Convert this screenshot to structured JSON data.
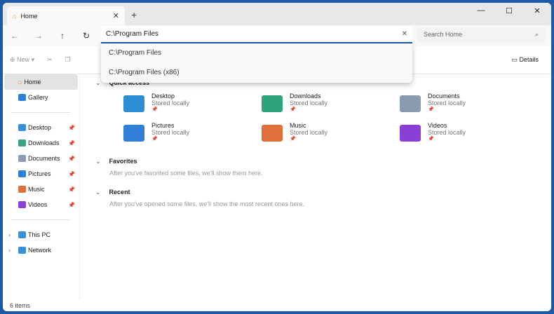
{
  "tab": {
    "title": "Home",
    "close": "✕",
    "new": "+"
  },
  "window_controls": {
    "minimize": "—",
    "maximize": "☐",
    "close": "✕"
  },
  "address": {
    "value": "C:\\Program Files",
    "clear": "✕"
  },
  "search": {
    "placeholder": "Search Home"
  },
  "suggestions": [
    "C:\\Program Files",
    "C:\\Program Files (x86)"
  ],
  "toolbar": {
    "new": "New",
    "details": "Details"
  },
  "sidebar": {
    "home": "Home",
    "gallery": "Gallery",
    "pinned": [
      {
        "label": "Desktop",
        "color": "#3a8fd6"
      },
      {
        "label": "Downloads",
        "color": "#3aa37a"
      },
      {
        "label": "Documents",
        "color": "#8a9bb0"
      },
      {
        "label": "Pictures",
        "color": "#2f7ed8"
      },
      {
        "label": "Music",
        "color": "#e0703a"
      },
      {
        "label": "Videos",
        "color": "#8a3fd6"
      }
    ],
    "this_pc": "This PC",
    "network": "Network"
  },
  "main": {
    "quick_access": "Quick access",
    "items": [
      {
        "name": "Desktop",
        "sub": "Stored locally",
        "color": "#2f8fd6"
      },
      {
        "name": "Downloads",
        "sub": "Stored locally",
        "color": "#2fa37a"
      },
      {
        "name": "Documents",
        "sub": "Stored locally",
        "color": "#8a9bb0"
      },
      {
        "name": "Pictures",
        "sub": "Stored locally",
        "color": "#2f7ed8"
      },
      {
        "name": "Music",
        "sub": "Stored locally",
        "color": "#e0703a"
      },
      {
        "name": "Videos",
        "sub": "Stored locally",
        "color": "#8a3fd6"
      }
    ],
    "favorites": "Favorites",
    "favorites_hint": "After you've favorited some files, we'll show them here.",
    "recent": "Recent",
    "recent_hint": "After you've opened some files, we'll show the most recent ones here."
  },
  "status": "6 items"
}
